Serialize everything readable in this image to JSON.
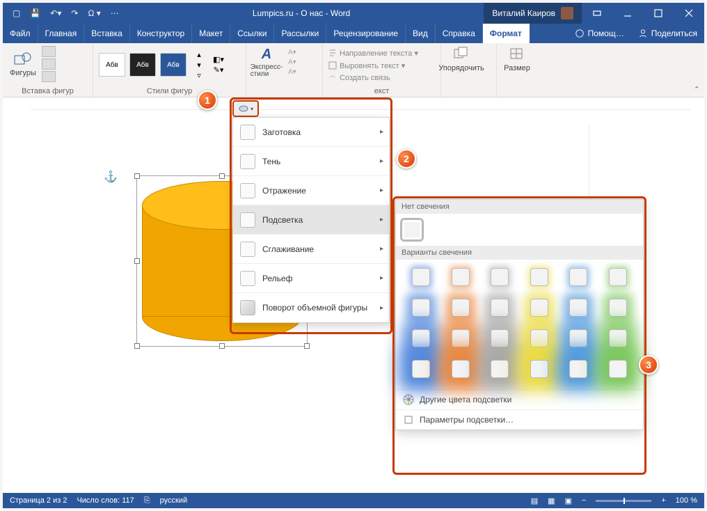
{
  "titlebar": {
    "title": "Lumpics.ru - О нас  -  Word",
    "user": "Виталий Каиров"
  },
  "menubar": {
    "tabs": [
      "Файл",
      "Главная",
      "Вставка",
      "Конструктор",
      "Макет",
      "Ссылки",
      "Рассылки",
      "Рецензирование",
      "Вид",
      "Справка",
      "Формат"
    ],
    "active": "Формат",
    "help_bulb": "Помощ…",
    "share": "Поделиться"
  },
  "ribbon": {
    "g_insert": {
      "btn": "Фигуры",
      "label": "Вставка фигур"
    },
    "g_styles": {
      "swatch": "Абв",
      "label": "Стили фигур"
    },
    "g_wordart": {
      "btn": "Экспресс-стили"
    },
    "g_text": {
      "dir": "Направление текста ▾",
      "align": "Выровнять текст ▾",
      "link": "Создать связь",
      "label": "екст"
    },
    "g_arrange": {
      "btn": "Упорядочить"
    },
    "g_size": {
      "btn": "Размер"
    }
  },
  "effects_menu": {
    "items": [
      {
        "label": "Заготовка"
      },
      {
        "label": "Тень"
      },
      {
        "label": "Отражение"
      },
      {
        "label": "Подсветка"
      },
      {
        "label": "Сглаживание"
      },
      {
        "label": "Рельеф"
      },
      {
        "label": "Поворот объемной фигуры"
      }
    ]
  },
  "glow_menu": {
    "no_glow_header": "Нет свечения",
    "variants_header": "Варианты свечения",
    "glow_colors": [
      "#3f7bd9",
      "#e87a2a",
      "#9e9e9e",
      "#e8d72a",
      "#3f8fd9",
      "#6cc24a"
    ],
    "glow_rows": 4,
    "more_colors": "Другие цвета подсветки",
    "options": "Параметры подсветки…"
  },
  "badges": {
    "b1": "1",
    "b2": "2",
    "b3": "3"
  },
  "status": {
    "page": "Страница 2 из 2",
    "words": "Число слов: 117",
    "lang": "русский",
    "zoom": "100 %"
  }
}
